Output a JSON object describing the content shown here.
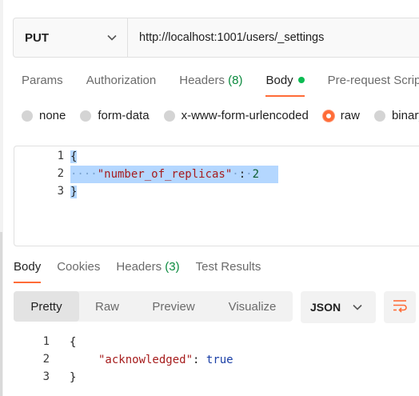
{
  "request": {
    "method": "PUT",
    "url": "http://localhost:1001/users/_settings"
  },
  "request_tabs": [
    {
      "label": "Params"
    },
    {
      "label": "Authorization"
    },
    {
      "label": "Headers",
      "count": "(8)"
    },
    {
      "label": "Body"
    },
    {
      "label": "Pre-request Script"
    }
  ],
  "body_types": {
    "none": "none",
    "form_data": "form-data",
    "urlencoded": "x-www-form-urlencoded",
    "raw": "raw",
    "binary": "binary",
    "selected": "raw"
  },
  "request_body": {
    "line_numbers": [
      "1",
      "2",
      "3"
    ],
    "open_brace": "{",
    "key": "\"number_of_replicas\"",
    "colon": ":",
    "value": "2",
    "close_brace": "}"
  },
  "response_tabs": [
    {
      "label": "Body"
    },
    {
      "label": "Cookies"
    },
    {
      "label": "Headers",
      "count": "(3)"
    },
    {
      "label": "Test Results"
    }
  ],
  "response_view": {
    "modes": [
      "Pretty",
      "Raw",
      "Preview",
      "Visualize"
    ],
    "selected": "Pretty",
    "format": "JSON"
  },
  "response_body": {
    "line_numbers": [
      "1",
      "2",
      "3"
    ],
    "open_brace": "{",
    "key": "\"acknowledged\"",
    "colon": ":",
    "value": "true",
    "close_brace": "}"
  },
  "colors": {
    "accent": "#ff6c37",
    "green": "#0cbb52",
    "selection": "#b4d7ff"
  }
}
